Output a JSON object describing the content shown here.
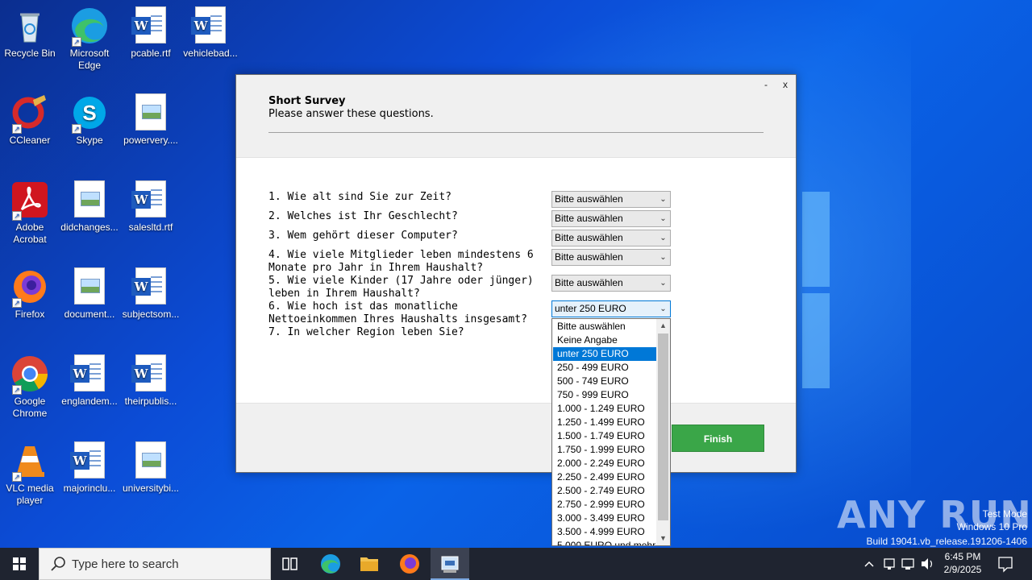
{
  "desktop": {
    "icons": [
      {
        "label": "Recycle Bin"
      },
      {
        "label": "Microsoft Edge"
      },
      {
        "label": "pcable.rtf"
      },
      {
        "label": "vehiclebad..."
      },
      {
        "label": "CCleaner"
      },
      {
        "label": "Skype"
      },
      {
        "label": "powervery...."
      },
      {
        "label": "Adobe Acrobat"
      },
      {
        "label": "didchanges..."
      },
      {
        "label": "salesltd.rtf"
      },
      {
        "label": "Firefox"
      },
      {
        "label": "document..."
      },
      {
        "label": "subjectsom..."
      },
      {
        "label": "Google Chrome"
      },
      {
        "label": "englandem..."
      },
      {
        "label": "theirpublis..."
      },
      {
        "label": "VLC media player"
      },
      {
        "label": "majorinclu..."
      },
      {
        "label": "universitybi..."
      }
    ]
  },
  "dialog": {
    "minimize": "-",
    "close": "x",
    "title": "Short Survey",
    "subtitle": "Please answer these questions.",
    "questions": [
      {
        "text": "1. Wie alt sind Sie zur Zeit?",
        "value": "Bitte auswählen"
      },
      {
        "text": "2. Welches ist Ihr Geschlecht?",
        "value": "Bitte auswählen"
      },
      {
        "text": "3. Wem gehört dieser Computer?",
        "value": "Bitte auswählen"
      },
      {
        "text": "4. Wie viele Mitglieder leben mindestens 6 Monate pro Jahr in Ihrem Haushalt?",
        "value": "Bitte auswählen"
      },
      {
        "text": "5. Wie viele Kinder (17 Jahre oder jünger) leben in Ihrem Haushalt?",
        "value": "Bitte auswählen"
      },
      {
        "text": "6. Wie hoch ist das monatliche Nettoeinkommen Ihres Haushalts insgesamt?",
        "value": "unter 250 EURO"
      },
      {
        "text": "7. In welcher Region leben Sie?"
      }
    ],
    "finish_label": "Finish"
  },
  "dropdown": {
    "selected": "unter 250 EURO",
    "options": [
      "Bitte auswählen",
      "Keine Angabe",
      "unter 250 EURO",
      "250 - 499 EURO",
      "500 - 749 EURO",
      "750 - 999 EURO",
      "1.000 - 1.249 EURO",
      "1.250 - 1.499 EURO",
      "1.500 - 1.749 EURO",
      "1.750 - 1.999 EURO",
      "2.000 - 2.249 EURO",
      "2.250 - 2.499 EURO",
      "2.500 - 2.749 EURO",
      "2.750 - 2.999 EURO",
      "3.000 - 3.499 EURO",
      "3.500 - 4.999 EURO",
      "5.000 EURO und mehr"
    ]
  },
  "watermark": {
    "brand": "ANY RUN",
    "line1": "Test Mode",
    "line2": "Windows 10 Pro",
    "line3": "Build 19041.vb_release.191206-1406"
  },
  "taskbar": {
    "search_placeholder": "Type here to search",
    "time": "6:45 PM",
    "date": "2/9/2025"
  },
  "colors": {
    "finish_button": "#3aa648",
    "selection": "#0078d7",
    "taskbar": "#1f2430"
  }
}
